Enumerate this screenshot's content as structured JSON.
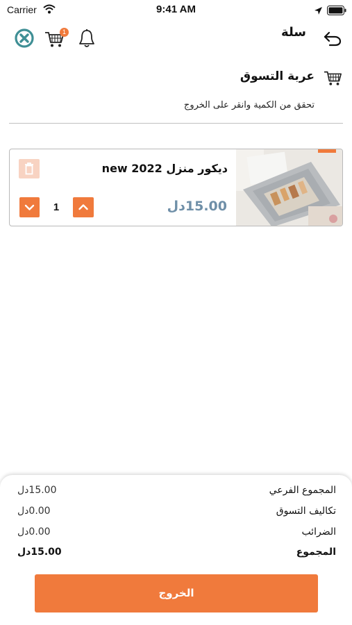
{
  "status_bar": {
    "carrier": "Carrier",
    "time": "9:41 AM",
    "icons": [
      "wifi-icon",
      "location-arrow-icon",
      "battery-icon"
    ]
  },
  "nav": {
    "title": "سلة",
    "cart_badge": "1",
    "icons": [
      "brand-logo-icon",
      "cart-icon",
      "bell-icon",
      "back-arrow-icon"
    ]
  },
  "section": {
    "title": "عربة التسوق",
    "subtitle": "تحقق من الكمية وانقر على الخروج",
    "icon": "shopping-cart-icon"
  },
  "cart_items": [
    {
      "name": "ديكور منزل 2022 new",
      "price": "15.00دل",
      "quantity": "1",
      "icons": [
        "trash-icon",
        "chevron-down-icon",
        "chevron-up-icon"
      ]
    }
  ],
  "summary": {
    "subtotal_label": "المجموع الفرعي",
    "subtotal_value": "15.00دل",
    "shipping_label": "تكاليف التسوق",
    "shipping_value": "0.00دل",
    "taxes_label": "الضرائب",
    "taxes_value": "0.00دل",
    "total_label": "المجموع",
    "total_value": "15.00دل"
  },
  "checkout_label": "الخروج",
  "colors": {
    "accent": "#f07a3c",
    "accent_light": "#f8d3c2",
    "price": "#6f8fa8",
    "logo": "#3f8f95"
  }
}
